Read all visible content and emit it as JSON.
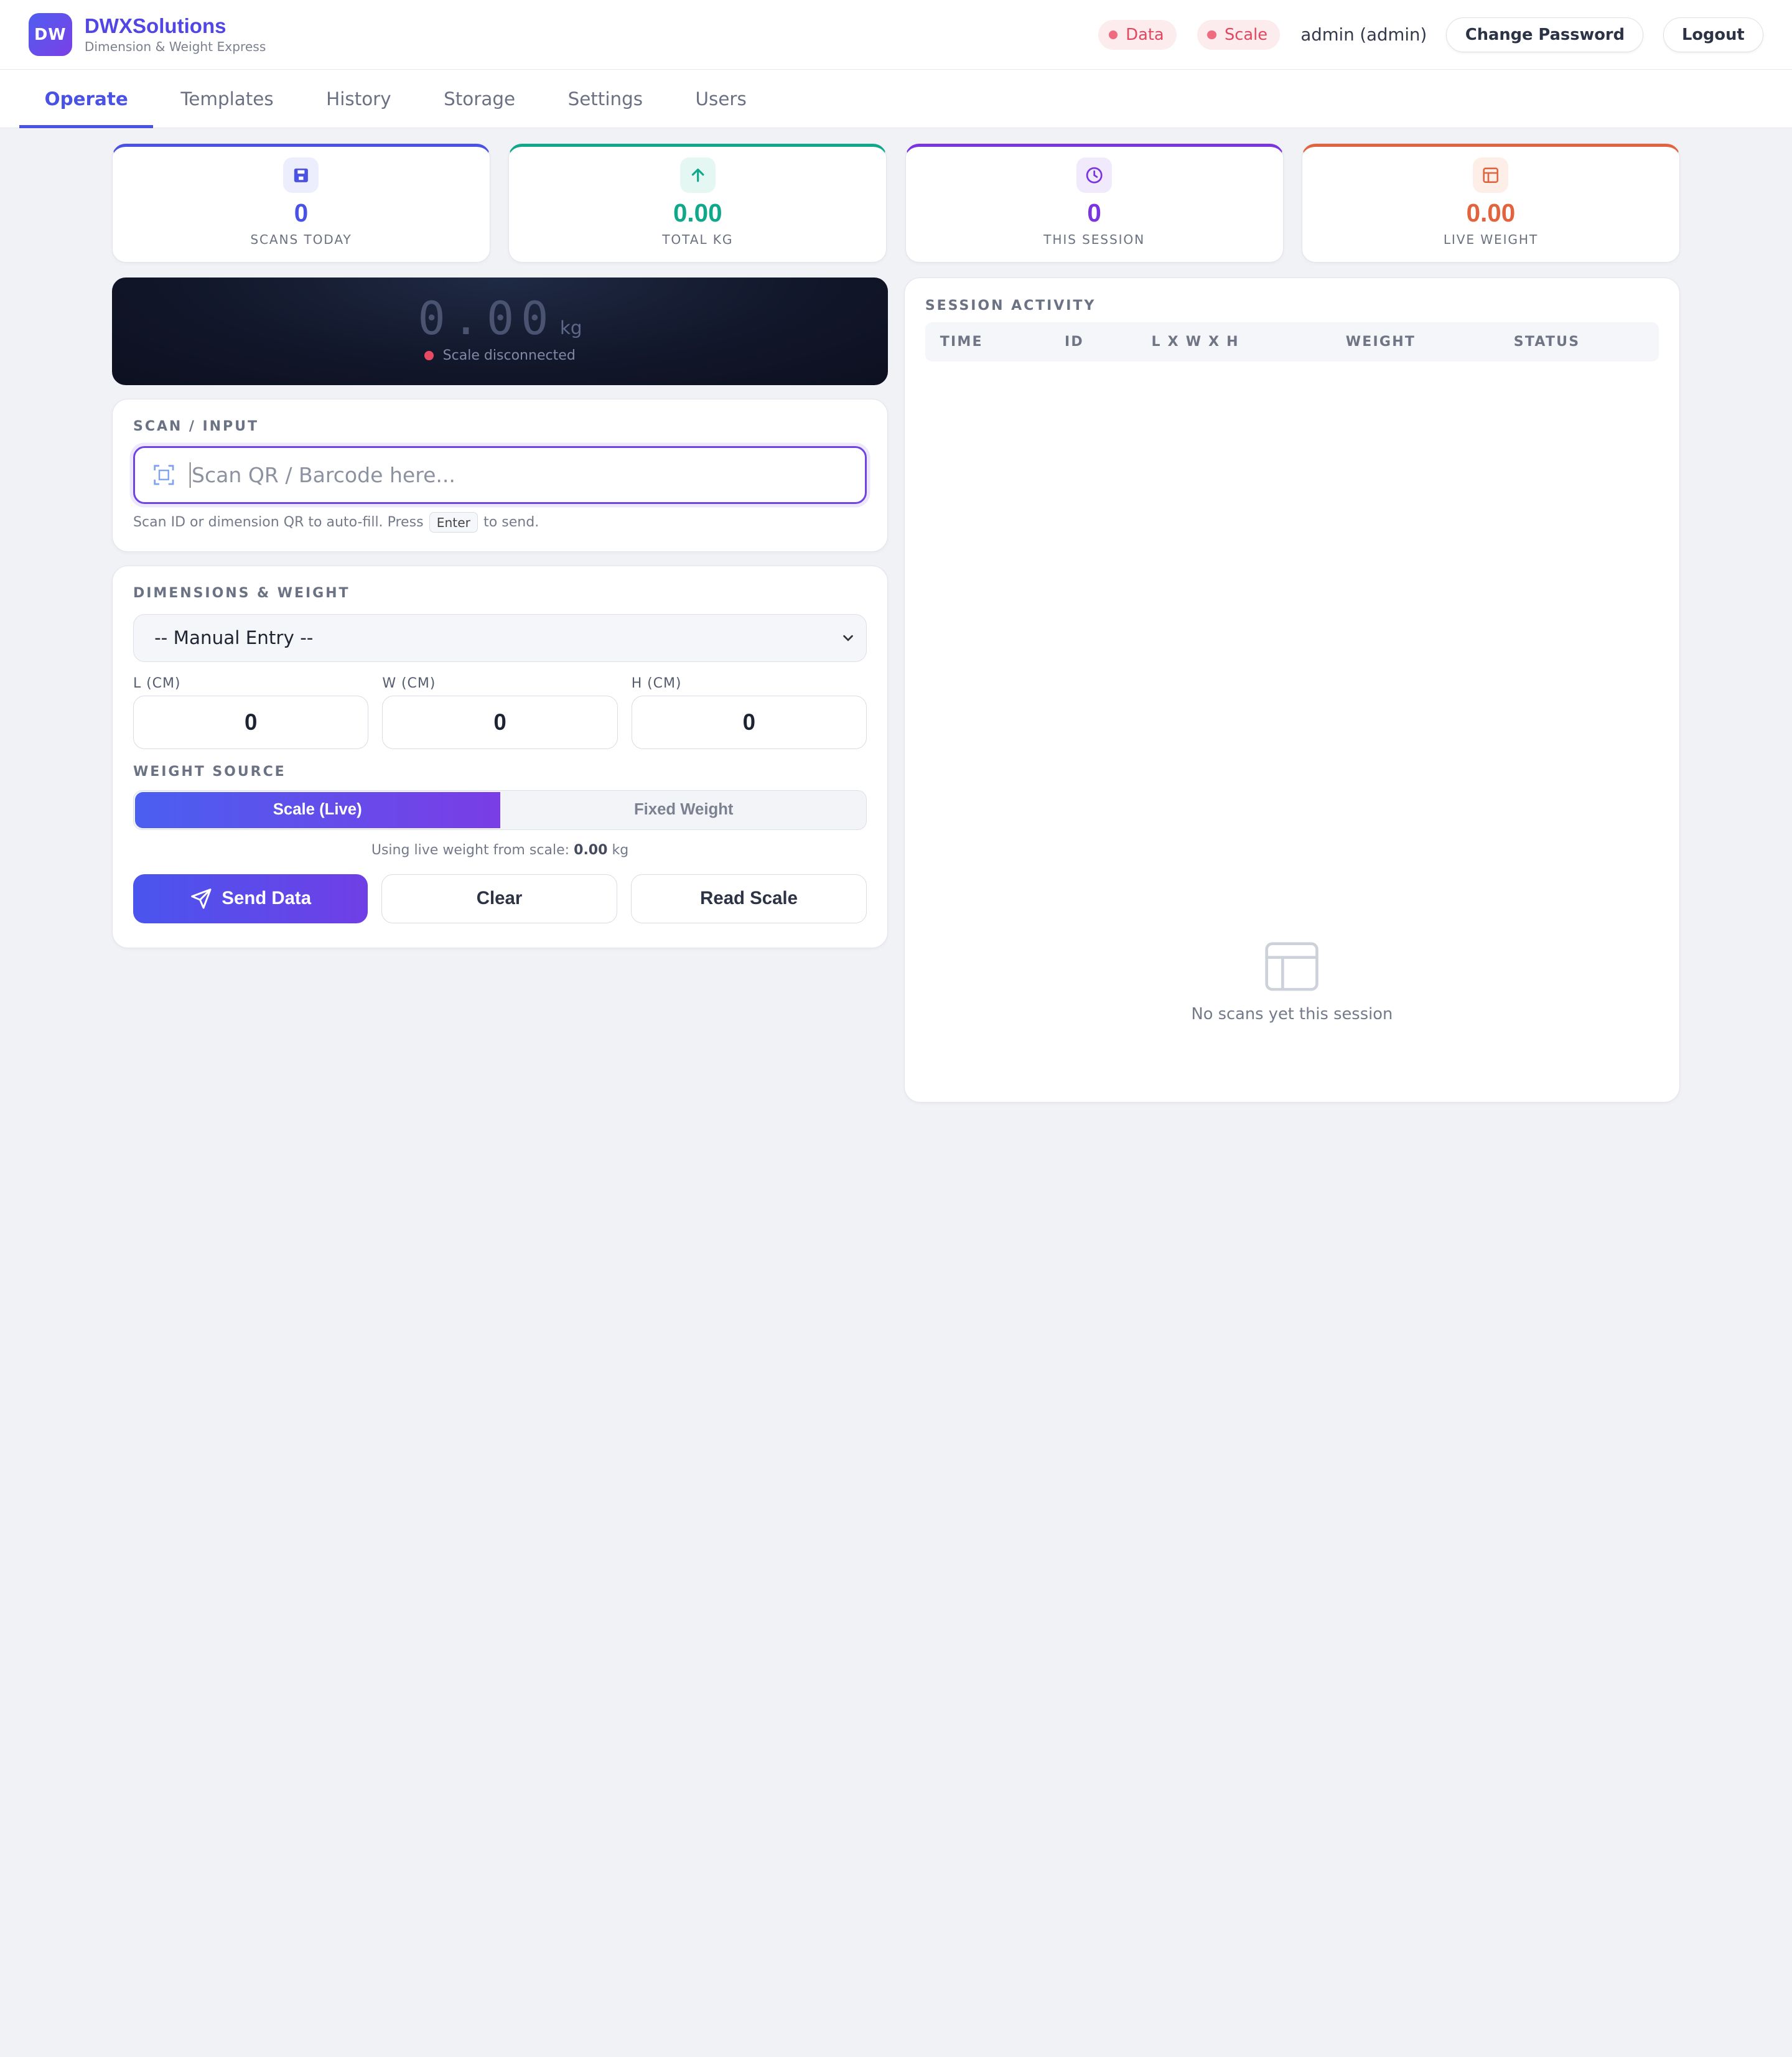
{
  "brand": {
    "logo": "DW",
    "name": "DWXSolutions",
    "subtitle": "Dimension & Weight Express"
  },
  "header": {
    "status_data": "Data",
    "status_scale": "Scale",
    "user": "admin (admin)",
    "change_password": "Change Password",
    "logout": "Logout"
  },
  "tabs": [
    "Operate",
    "Templates",
    "History",
    "Storage",
    "Settings",
    "Users"
  ],
  "stats": [
    {
      "icon": "save-icon",
      "value": "0",
      "label": "SCANS TODAY",
      "color": "#4a52e6"
    },
    {
      "icon": "arrow-up-icon",
      "value": "0.00",
      "label": "TOTAL KG",
      "color": "#0fa88a"
    },
    {
      "icon": "clock-icon",
      "value": "0",
      "label": "THIS SESSION",
      "color": "#7a35e0"
    },
    {
      "icon": "layout-icon",
      "value": "0.00",
      "label": "LIVE WEIGHT",
      "color": "#e2643e"
    }
  ],
  "scale": {
    "value": "0.00",
    "unit": "kg",
    "status": "Scale disconnected"
  },
  "scan": {
    "label": "SCAN / INPUT",
    "placeholder": "Scan QR / Barcode here...",
    "hint_before": "Scan ID or dimension QR to auto-fill. Press",
    "hint_key": "Enter",
    "hint_after": "to send."
  },
  "dimensions": {
    "label": "DIMENSIONS & WEIGHT",
    "template_selected": "-- Manual Entry --",
    "fields": [
      {
        "label": "L (CM)",
        "value": "0"
      },
      {
        "label": "W (CM)",
        "value": "0"
      },
      {
        "label": "H (CM)",
        "value": "0"
      }
    ],
    "weight_source_label": "WEIGHT SOURCE",
    "weight_source_options": [
      "Scale (Live)",
      "Fixed Weight"
    ],
    "weight_source_selected": "Scale (Live)",
    "note_prefix": "Using live weight from scale:",
    "note_value": "0.00",
    "note_unit": "kg"
  },
  "actions": {
    "send": "Send Data",
    "clear": "Clear",
    "read_scale": "Read Scale"
  },
  "activity": {
    "label": "SESSION ACTIVITY",
    "columns": [
      "TIME",
      "ID",
      "L X W X H",
      "WEIGHT",
      "STATUS"
    ],
    "rows": [],
    "empty_text": "No scans yet this session"
  }
}
